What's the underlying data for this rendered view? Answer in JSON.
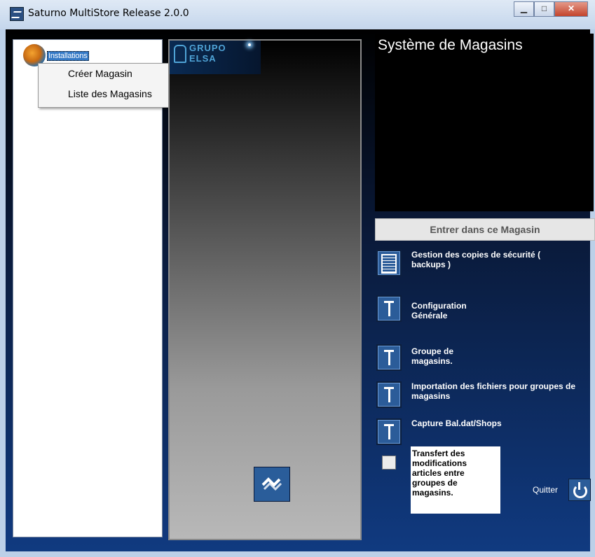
{
  "window": {
    "title": "Saturno MultiStore Release 2.0.0"
  },
  "tree": {
    "root_label": "Installations"
  },
  "context_menu": {
    "items": [
      {
        "label": "Créer Magasin"
      },
      {
        "label": "Liste des Magasins"
      }
    ]
  },
  "logo": {
    "line1": "GRUPO",
    "line2": "ELSA"
  },
  "store_panel": {
    "title": "Système de Magasins",
    "enter_button": "Entrer dans ce Magasin"
  },
  "actions": [
    {
      "label": "Gestion des copies de sécurité ( backups )",
      "icon": "backup-document-icon"
    },
    {
      "label": "Configuration Générale",
      "icon": "tool-icon"
    },
    {
      "label": "Groupe de magasins.",
      "icon": "tool-icon"
    },
    {
      "label": "Importation des fichiers pour groupes de magasins",
      "icon": "tool-icon"
    },
    {
      "label": "Capture Bal.dat/Shops",
      "icon": "tool-icon"
    }
  ],
  "transfer": {
    "label": "Transfert des modifications articles entre groupes de magasins.",
    "checked": false
  },
  "quit": {
    "label": "Quitter"
  },
  "colors": {
    "background_top": "#000000",
    "background_bottom": "#103a80",
    "selection": "#3378c5"
  }
}
